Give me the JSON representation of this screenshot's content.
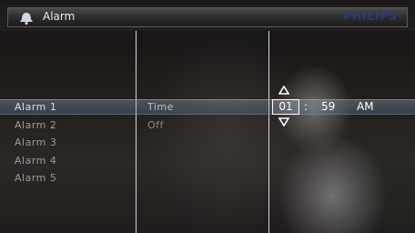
{
  "header": {
    "title": "Alarm",
    "brand": "PHILIPS",
    "icon": "alarm-bell-icon"
  },
  "alarms": [
    {
      "label": "Alarm 1",
      "selected": true
    },
    {
      "label": "Alarm 2",
      "selected": false
    },
    {
      "label": "Alarm 3",
      "selected": false
    },
    {
      "label": "Alarm 4",
      "selected": false
    },
    {
      "label": "Alarm 5",
      "selected": false
    }
  ],
  "settings": [
    {
      "label": "Time",
      "selected": true
    },
    {
      "label": "Off",
      "selected": false
    }
  ],
  "time": {
    "hour": "01",
    "separator": ":",
    "minute": "59",
    "period": "AM",
    "up_icon": "triangle-up-icon",
    "down_icon": "triangle-down-icon"
  },
  "colors": {
    "highlight": "#8aa6bd",
    "text_active": "#ffffff",
    "text_inactive": "#9a9a9a"
  }
}
